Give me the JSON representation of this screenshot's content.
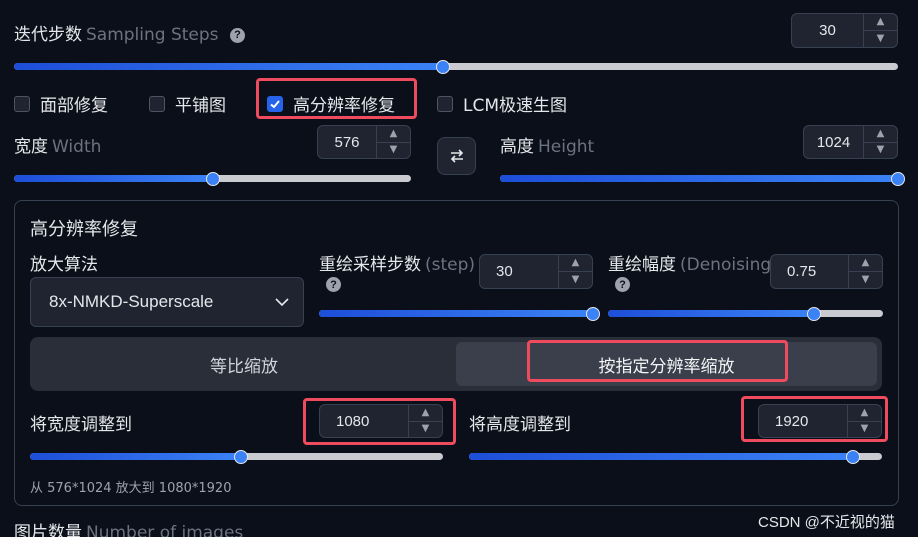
{
  "sampling": {
    "label": "迭代步数",
    "label_en": "Sampling Steps",
    "value": "30",
    "slider_fraction": 0.48
  },
  "options": [
    {
      "label": "面部修复",
      "checked": false
    },
    {
      "label": "平铺图",
      "checked": false
    },
    {
      "label": "高分辨率修复",
      "checked": true
    },
    {
      "label": "LCM极速生图",
      "checked": false
    }
  ],
  "width": {
    "label": "宽度",
    "label_en": "Width",
    "value": "576",
    "slider_fraction": 0.5
  },
  "height": {
    "label": "高度",
    "label_en": "Height",
    "value": "1024",
    "slider_fraction": 1.0
  },
  "swap_icon": "swap-icon",
  "hires": {
    "title": "高分辨率修复",
    "upscaler_label": "放大算法",
    "upscaler_value": "8x-NMKD-Superscale",
    "steps_label": "重绘采样步数",
    "steps_label_en": "(step)",
    "steps_value": "30",
    "steps_fraction": 1.0,
    "denoise_label": "重绘幅度",
    "denoise_label_en": "(Denoising)",
    "denoise_value": "0.75",
    "denoise_fraction": 0.75,
    "tab_ratio": "等比缩放",
    "tab_resolution": "按指定分辨率缩放",
    "target_width_label": "将宽度调整到",
    "target_width_value": "1080",
    "target_width_fraction": 0.51,
    "target_height_label": "将高度调整到",
    "target_height_value": "1920",
    "target_height_fraction": 0.93,
    "summary": "从 576*1024 放大到 1080*1920"
  },
  "images_count": {
    "label": "图片数量",
    "label_en": "Number of images"
  },
  "watermark": "CSDN @不近视的猫",
  "colors": {
    "accent": "#3b82f6",
    "highlight": "#ef4b5f",
    "background": "#0b0f19"
  }
}
